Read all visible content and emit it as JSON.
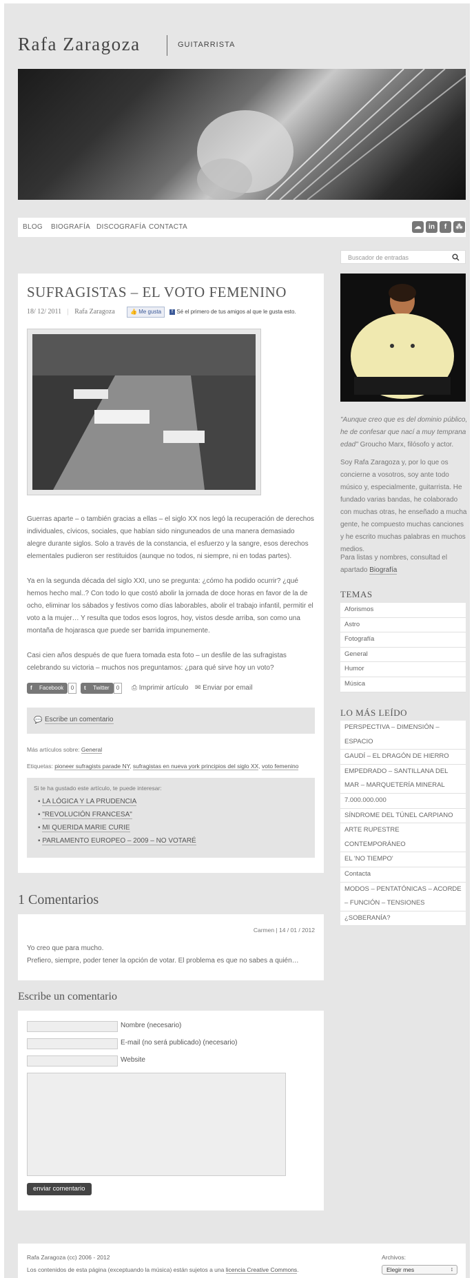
{
  "header": {
    "logo_name": "Rafa Zaragoza",
    "logo_sub": "GUITARRISTA"
  },
  "nav": {
    "items": [
      "BLOG",
      "BIOGRAFÍA",
      "DISCOGRAFÍA",
      "CONTACTA"
    ],
    "social": [
      "soundcloud-icon",
      "linkedin-icon",
      "facebook-icon",
      "myspace-icon"
    ]
  },
  "article": {
    "title": "SUFRAGISTAS – EL VOTO FEMENINO",
    "date": "18/ 12/ 2011",
    "author": "Rafa Zaragoza",
    "fb_like": "Me gusta",
    "fb_text": "Sé el primero de tus amigos al que le gusta esto.",
    "paragraphs": [
      "Guerras aparte – o también gracias a ellas – el siglo XX nos legó la recuperación de derechos individuales, cívicos, sociales, que habían sido ninguneados de una manera demasiado alegre durante siglos. Solo a través de la constancia, el esfuerzo y la sangre, esos derechos elementales pudieron ser restituidos (aunque no todos, ni siempre, ni en todas partes).",
      "Ya en la segunda década del siglo XXI, uno se pregunta: ¿cómo ha podido ocurrir? ¿qué hemos hecho mal..? Con todo lo que costó abolir la jornada de doce horas en favor de la de ocho, eliminar los sábados y festivos como días laborables, abolir el trabajo infantil, permitir el voto a la mujer… Y resulta que todos esos logros, hoy, vistos desde arriba, son como una montaña de hojarasca que puede ser barrida impunemente.",
      "Casi cien años después de que fuera tomada esta foto – un desfile de las sufragistas celebrando su victoria – muchos nos preguntamos: ¿para qué sirve hoy un voto?"
    ],
    "share": {
      "facebook": "Facebook",
      "facebook_count": "0",
      "twitter": "Twitter",
      "twitter_count": "0",
      "print": "Imprimir artículo",
      "email": "Enviar por email"
    },
    "write_comment": "Escribe un comentario",
    "more_label": "Más artículos sobre:",
    "more_category": "General",
    "tags_label": "Etiquetas:",
    "tags": [
      "pioneer sufragists parade NY",
      "sufragistas en nueva york principios del siglo XX",
      "voto femenino"
    ],
    "related_title": "Si te ha gustado este artículo, te puede interesar:",
    "related": [
      "LA LÓGICA Y LA PRUDENCIA",
      "\"REVOLUCIÓN FRANCESA\"",
      "MI QUERIDA MARIE CURIE",
      "PARLAMENTO EUROPEO – 2009 – NO VOTARÉ"
    ]
  },
  "sidebar": {
    "search_placeholder": "Buscador de entradas",
    "quote": "\"Aunque creo que es del dominio público, he de confesar que nací a muy temprana edad\"",
    "quote_author": " Groucho Marx, filósofo y actor.",
    "bio": "Soy Rafa Zaragoza y, por lo que os concierne a vosotros, soy ante todo músico y, especialmente, guitarrista. He fundado varias bandas, he colaborado con muchas otras, he enseñado a mucha gente, he compuesto muchas canciones y he escrito muchas palabras en muchos medios.",
    "bio2": "Para listas y nombres, consultad el apartado ",
    "bio_link": "Biografía",
    "temas_title": "TEMAS",
    "temas": [
      "Aforismos",
      "Astro",
      "Fotografía",
      "General",
      "Humor",
      "Música"
    ],
    "leido_title": "LO MÁS LEÍDO",
    "leido": [
      "PERSPECTIVA – DIMENSIÓN – ESPACIO",
      "GAUDÍ – EL DRAGÓN DE HIERRO",
      "EMPEDRADO – SANTILLANA DEL MAR – MARQUETERÍA MINERAL",
      "7.000.000.000",
      "SÍNDROME DEL TÚNEL CARPIANO",
      "ARTE RUPESTRE CONTEMPORÁNEO",
      "EL 'NO TIEMPO'",
      "Contacta",
      "MODOS – PENTATÓNICAS – ACORDE – FUNCIÓN – TENSIONES",
      "¿SOBERANÍA?"
    ]
  },
  "comments": {
    "heading": "1 Comentarios",
    "items": [
      {
        "meta": "Carmen | 14 / 01 / 2012",
        "line1": "Yo creo que para mucho.",
        "line2": "Prefiero, siempre, poder tener la opción de votar. El problema es que no sabes a quién…"
      }
    ]
  },
  "form": {
    "heading": "Escribe un comentario",
    "name_label": "Nombre (necesario)",
    "email_label": "E-mail (no será publicado) (necesario)",
    "website_label": "Website",
    "submit": "enviar comentario"
  },
  "footer": {
    "copyright": "Rafa Zaragoza (cc) 2006 - 2012",
    "license_text": "Los contenidos de esta página (exceptuando la música) están sujetos a una ",
    "license_link": "licencia Creative Commons",
    "archives_label": "Archivos:",
    "archives_select": "Elegir mes"
  }
}
